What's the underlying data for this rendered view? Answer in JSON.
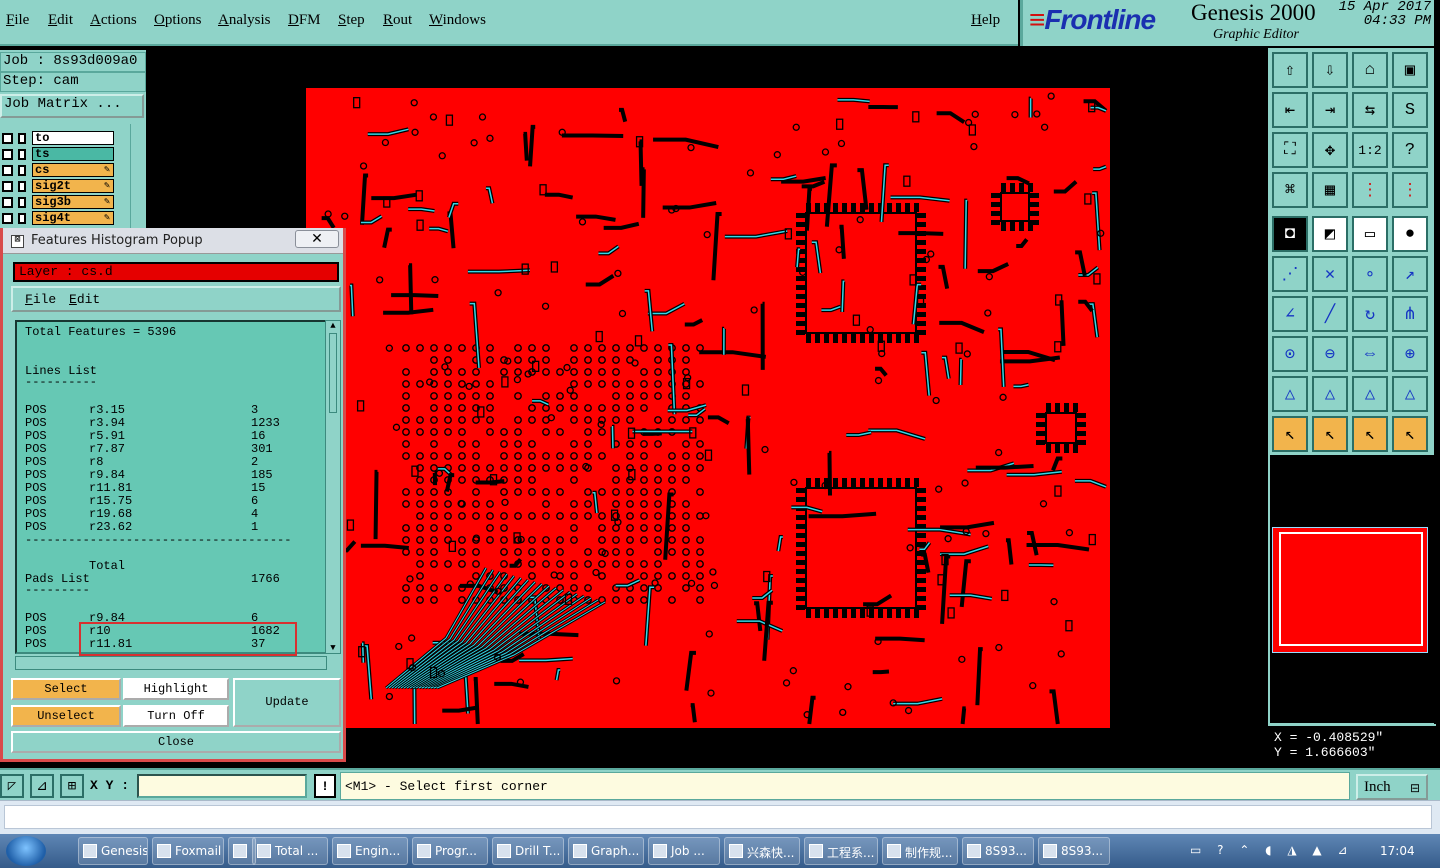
{
  "menubar": {
    "items": [
      "File",
      "Edit",
      "Actions",
      "Options",
      "Analysis",
      "DFM",
      "Step",
      "Rout",
      "Windows"
    ],
    "help": "Help"
  },
  "brand": {
    "logo": "Frontline",
    "product": "Genesis 2000",
    "subtitle": "Graphic Editor",
    "date": "15 Apr 2017",
    "time": "04:33 PM"
  },
  "job": {
    "job_line": "Job : 8s93d009a0",
    "step_line": "Step: cam",
    "matrix_button": "Job Matrix ...",
    "layers": [
      {
        "name": "to",
        "color": "white",
        "editable": false
      },
      {
        "name": "ts",
        "color": "teal",
        "editable": false
      },
      {
        "name": "cs",
        "color": "orange",
        "editable": true
      },
      {
        "name": "sig2t",
        "color": "orange",
        "editable": true
      },
      {
        "name": "sig3b",
        "color": "orange",
        "editable": true
      },
      {
        "name": "sig4t",
        "color": "orange",
        "editable": true
      }
    ]
  },
  "popup": {
    "title": "Features Histogram Popup",
    "close_glyph": "✕",
    "layer_field": "Layer :  cs.d",
    "menu": [
      "File",
      "Edit"
    ],
    "total_features": "Total Features = 5396",
    "lines_heading": "Lines List",
    "lines_rule": "----------",
    "lines": [
      {
        "pol": "POS",
        "sym": "r3.15",
        "count": "3"
      },
      {
        "pol": "POS",
        "sym": "r3.94",
        "count": "1233"
      },
      {
        "pol": "POS",
        "sym": "r5.91",
        "count": "16"
      },
      {
        "pol": "POS",
        "sym": "r7.87",
        "count": "301"
      },
      {
        "pol": "POS",
        "sym": "r8",
        "count": "2"
      },
      {
        "pol": "POS",
        "sym": "r9.84",
        "count": "185"
      },
      {
        "pol": "POS",
        "sym": "r11.81",
        "count": "15"
      },
      {
        "pol": "POS",
        "sym": "r15.75",
        "count": "6"
      },
      {
        "pol": "POS",
        "sym": "r19.68",
        "count": "4"
      },
      {
        "pol": "POS",
        "sym": "r23.62",
        "count": "1"
      }
    ],
    "divider": "-------------------------------------",
    "total_label": "Total",
    "total_value": "1766",
    "pads_heading": "Pads List",
    "pads_rule": "---------",
    "pads": [
      {
        "pol": "POS",
        "sym": "r9.84",
        "count": "6"
      },
      {
        "pol": "POS",
        "sym": "r10",
        "count": "1682"
      },
      {
        "pol": "POS",
        "sym": "r11.81",
        "count": "37"
      }
    ],
    "buttons": {
      "select": "Select",
      "unselect": "Unselect",
      "highlight": "Highlight",
      "turn_off": "Turn Off",
      "update": "Update",
      "close": "Close"
    }
  },
  "tools": {
    "rows": [
      [
        "layer-top-icon",
        "layer-down-icon",
        "home-icon",
        "window-icon"
      ],
      [
        "pan-left-icon",
        "pan-right-icon",
        "zoom-prev-icon",
        "redraw-icon"
      ],
      [
        "zoom-fit-icon",
        "zoom-center-icon",
        "zoom-1to1-icon",
        "help-icon"
      ],
      [
        "measure-icon",
        "grid-icon",
        "snap-icon",
        "net-icon"
      ],
      [
        "fill-icon",
        "erase-icon",
        "ruler-icon",
        "pad-icon"
      ],
      [
        "connect-icon",
        "cross-icon",
        "point-icon",
        "arrow-point-icon"
      ],
      [
        "line-icon",
        "diagonal-icon",
        "arc-icon",
        "fork-icon"
      ],
      [
        "marker-icon",
        "split-icon",
        "stretch-icon",
        "group-icon"
      ],
      [
        "angle-icon",
        "angle-b-icon",
        "angle-c-icon",
        "angle-d-icon"
      ],
      [
        "cursor-icon",
        "cursor-b-icon",
        "cursor-c-icon",
        "cursor-d-icon"
      ]
    ],
    "glyphs": {
      "layer-top-icon": "⇧",
      "layer-down-icon": "⇩",
      "home-icon": "⌂",
      "window-icon": "▣",
      "pan-left-icon": "⇤",
      "pan-right-icon": "⇥",
      "zoom-prev-icon": "⇆",
      "redraw-icon": "S",
      "zoom-fit-icon": "⛶",
      "zoom-center-icon": "✥",
      "zoom-1to1-icon": "1:2",
      "help-icon": "?",
      "measure-icon": "⌘",
      "grid-icon": "▦",
      "snap-icon": "⋮",
      "net-icon": "⋮",
      "fill-icon": "◘",
      "erase-icon": "◩",
      "ruler-icon": "▭",
      "pad-icon": "●",
      "connect-icon": "⋰",
      "cross-icon": "✕",
      "point-icon": "∘",
      "arrow-point-icon": "↗",
      "line-icon": "∠",
      "diagonal-icon": "╱",
      "arc-icon": "↻",
      "fork-icon": "⋔",
      "marker-icon": "⊙",
      "split-icon": "⊖",
      "stretch-icon": "⇔",
      "group-icon": "⊕",
      "angle-icon": "△",
      "angle-b-icon": "△",
      "angle-c-icon": "△",
      "angle-d-icon": "△",
      "cursor-icon": "↖",
      "cursor-b-icon": "↖",
      "cursor-c-icon": "↖",
      "cursor-d-icon": "↖"
    }
  },
  "coords": {
    "x": "X = -0.408529\"",
    "y": "Y = 1.666603\""
  },
  "bottom": {
    "xy_label": "X Y :",
    "xy_value": "",
    "prompt": "<M1> - Select first corner",
    "units": "Inch"
  },
  "taskbar": {
    "tasks": [
      "Genesis",
      "Foxmail",
      "",
      "Total ...",
      "Engin...",
      "Progr...",
      "Drill T...",
      "Graph...",
      "Job ...",
      "兴森快...",
      "工程系...",
      "制作规...",
      "8S93...",
      "8S93..."
    ],
    "clock": "17:04"
  },
  "colors": {
    "ui_teal": "#8fd3c8",
    "board_red": "#ff0000",
    "trace_cyan": "#33d6e6",
    "highlight_red": "#d83030"
  }
}
